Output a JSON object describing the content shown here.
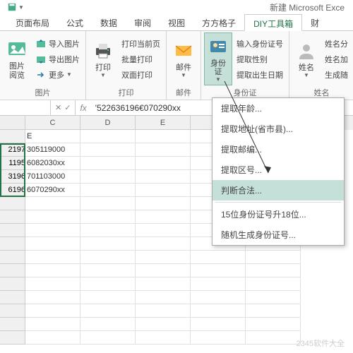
{
  "window": {
    "title": "新建 Microsoft Exce"
  },
  "tabs": [
    "页面布局",
    "公式",
    "数据",
    "审阅",
    "视图",
    "方方格子",
    "DIY工具箱",
    "财"
  ],
  "tabs_active": 6,
  "ribbon": {
    "group1": {
      "big": "图片\n阅览",
      "items": [
        "导入图片",
        "导出图片",
        "更多"
      ],
      "label": "图片"
    },
    "group2": {
      "big": "打印",
      "items": [
        "打印当前页",
        "批量打印",
        "双面打印"
      ],
      "label": "打印"
    },
    "group3": {
      "big": "邮件",
      "label": "邮件"
    },
    "group4": {
      "big": "身份\n证",
      "items": [
        "输入身份证号",
        "提取性别",
        "提取出生日期"
      ],
      "label": "身份证"
    },
    "group5": {
      "big": "姓名",
      "items": [
        "姓名分",
        "姓名加",
        "生成随"
      ],
      "label": "姓名"
    }
  },
  "formula": {
    "value": "'522636196€070290xx"
  },
  "grid": {
    "cols": [
      "C",
      "D",
      "E"
    ],
    "header_row": "E",
    "data": [
      "305119000",
      "6082030xx",
      "701103000",
      "6070290xx"
    ],
    "partial_left": [
      "2197",
      "1195",
      "3196",
      "6196"
    ]
  },
  "dropdown": {
    "items": [
      "提取年龄...",
      "提取地址(省市县)...",
      "提取邮编...",
      "提取区号...",
      "判断合法...",
      "15位身份证号升18位...",
      "随机生成身份证号..."
    ],
    "hover_index": 4
  },
  "watermark": "2345软件大全"
}
